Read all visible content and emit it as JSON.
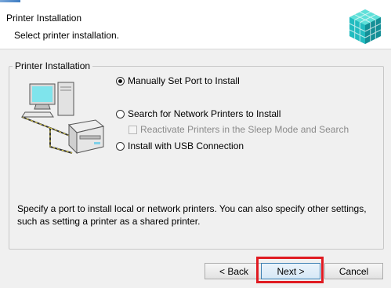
{
  "header": {
    "title": "Printer Installation",
    "subtitle": "Select printer installation.",
    "logo_icon": "installer-cube-logo"
  },
  "group": {
    "label": "Printer Installation",
    "illustration_icon": "computer-network-printer"
  },
  "options": {
    "manual": {
      "label": "Manually Set Port to Install",
      "checked": true
    },
    "network": {
      "label": "Search for Network Printers to Install",
      "checked": false
    },
    "reactivate": {
      "label": "Reactivate Printers in the Sleep Mode and Search",
      "checked": false,
      "enabled": false
    },
    "usb": {
      "label": "Install with USB Connection",
      "checked": false
    }
  },
  "description": "Specify a port to install local or network printers. You can also specify other settings, such as setting a printer as a shared printer.",
  "buttons": {
    "back": "< Back",
    "next": "Next >",
    "cancel": "Cancel"
  },
  "colors": {
    "highlight": "#e01b22",
    "logo": "#2fc4c4"
  }
}
